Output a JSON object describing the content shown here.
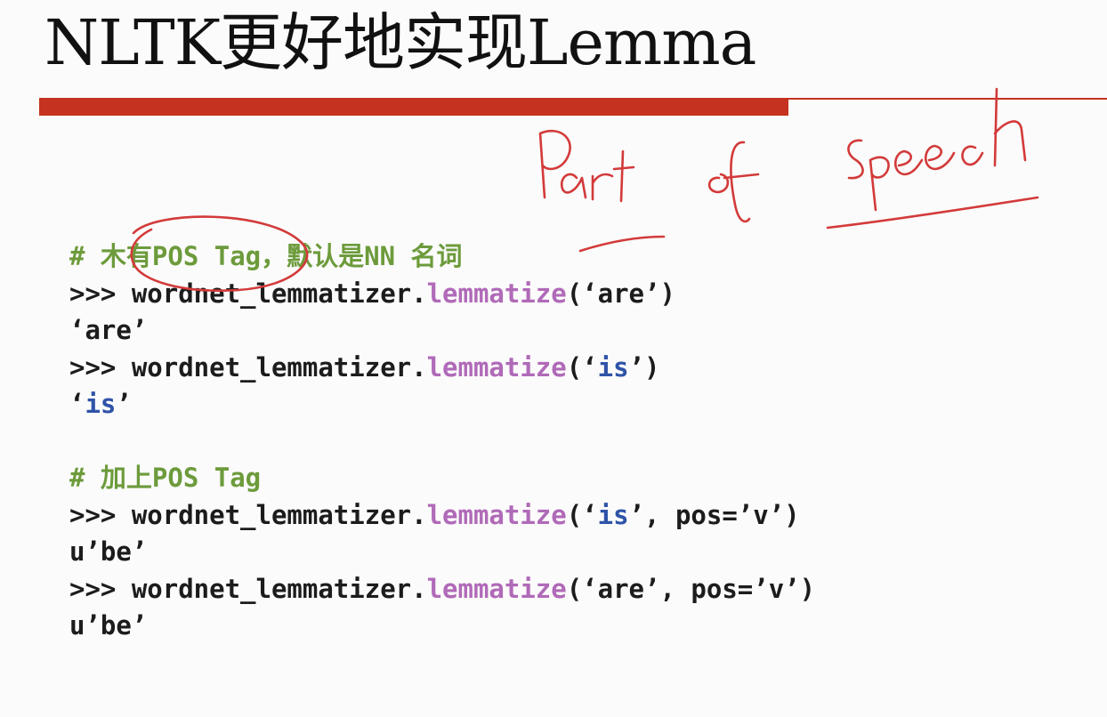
{
  "slide": {
    "title": "NLTK更好地实现Lemma",
    "annotation_text": "Part of speech"
  },
  "code": [
    {
      "parts": [
        {
          "text": "# 木有POS Tag，默认是NN 名词",
          "style": "comment"
        }
      ]
    },
    {
      "parts": [
        {
          "text": ">>> wordnet_lemmatizer.",
          "style": "normal"
        },
        {
          "text": "lemmatize",
          "style": "func"
        },
        {
          "text": "(‘are’)",
          "style": "normal"
        }
      ]
    },
    {
      "parts": [
        {
          "text": "‘are’",
          "style": "normal"
        }
      ]
    },
    {
      "parts": [
        {
          "text": ">>> wordnet_lemmatizer.",
          "style": "normal"
        },
        {
          "text": "lemmatize",
          "style": "func"
        },
        {
          "text": "(‘",
          "style": "normal"
        },
        {
          "text": "is",
          "style": "strblue"
        },
        {
          "text": "’)",
          "style": "normal"
        }
      ]
    },
    {
      "parts": [
        {
          "text": "‘",
          "style": "normal"
        },
        {
          "text": "is",
          "style": "strblue"
        },
        {
          "text": "’",
          "style": "normal"
        }
      ]
    },
    {
      "gap": true
    },
    {
      "parts": [
        {
          "text": "# 加上POS Tag",
          "style": "comment"
        }
      ]
    },
    {
      "parts": [
        {
          "text": ">>> wordnet_lemmatizer.",
          "style": "normal"
        },
        {
          "text": "lemmatize",
          "style": "func"
        },
        {
          "text": "(‘",
          "style": "normal"
        },
        {
          "text": "is",
          "style": "strblue"
        },
        {
          "text": "’, pos=’v’)",
          "style": "normal"
        }
      ]
    },
    {
      "parts": [
        {
          "text": "u’be’",
          "style": "normal"
        }
      ]
    },
    {
      "parts": [
        {
          "text": ">>> wordnet_lemmatizer.",
          "style": "normal"
        },
        {
          "text": "lemmatize",
          "style": "func"
        },
        {
          "text": "(‘are’, pos=’v’)",
          "style": "normal"
        }
      ]
    },
    {
      "parts": [
        {
          "text": "u’be’",
          "style": "normal"
        }
      ]
    }
  ],
  "colors": {
    "accent_red": "#c5321f",
    "comment_green": "#6d9b3c",
    "function_purple": "#b06ab8",
    "string_blue": "#2f53a8",
    "ink_red": "#d33a3a"
  }
}
